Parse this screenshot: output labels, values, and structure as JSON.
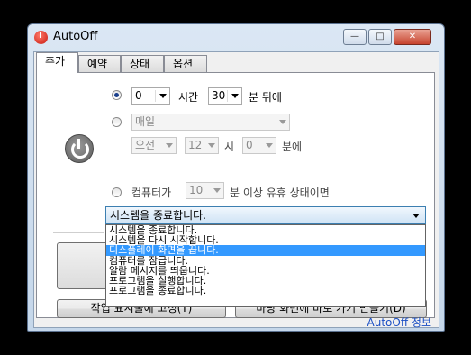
{
  "window": {
    "title": "AutoOff",
    "controls": {
      "minimize": "—",
      "maximize": "□",
      "close": "✕"
    }
  },
  "tabs": [
    {
      "label": "추가",
      "active": true
    },
    {
      "label": "예약",
      "active": false
    },
    {
      "label": "상태",
      "active": false
    },
    {
      "label": "옵션",
      "active": false
    }
  ],
  "timer": {
    "hours_value": "0",
    "hours_label": "시간",
    "minutes_value": "30",
    "minutes_after_label": "분 뒤에",
    "selected": true
  },
  "schedule": {
    "repeat_value": "매일",
    "ampm_value": "오전",
    "hour_value": "12",
    "hour_label": "시",
    "minute_value": "0",
    "minute_label": "분에"
  },
  "idle": {
    "prefix_label": "컴퓨터가",
    "minutes_value": "10",
    "suffix_label": "분 이상 유휴 상태이면"
  },
  "action": {
    "selected_value": "시스템을 종료합니다.",
    "options": [
      "시스템을 종료합니다.",
      "시스템을 다시 시작합니다.",
      "디스플레이 화면을 끕니다.",
      "컴퓨터를 잠급니다.",
      "알람 메시지를 띄웁니다.",
      "프로그램을 실행합니다.",
      "프로그램을 종료합니다."
    ],
    "highlighted_index": 2
  },
  "buttons": {
    "pin_taskbar": "작업 표시줄에 고정(T)",
    "desktop_shortcut": "바탕 화면에 바로 가기 만들기(D)"
  },
  "footer_link": "AutoOff 정보",
  "colors": {
    "highlight": "#3399ff",
    "link": "#1a4fc4"
  }
}
